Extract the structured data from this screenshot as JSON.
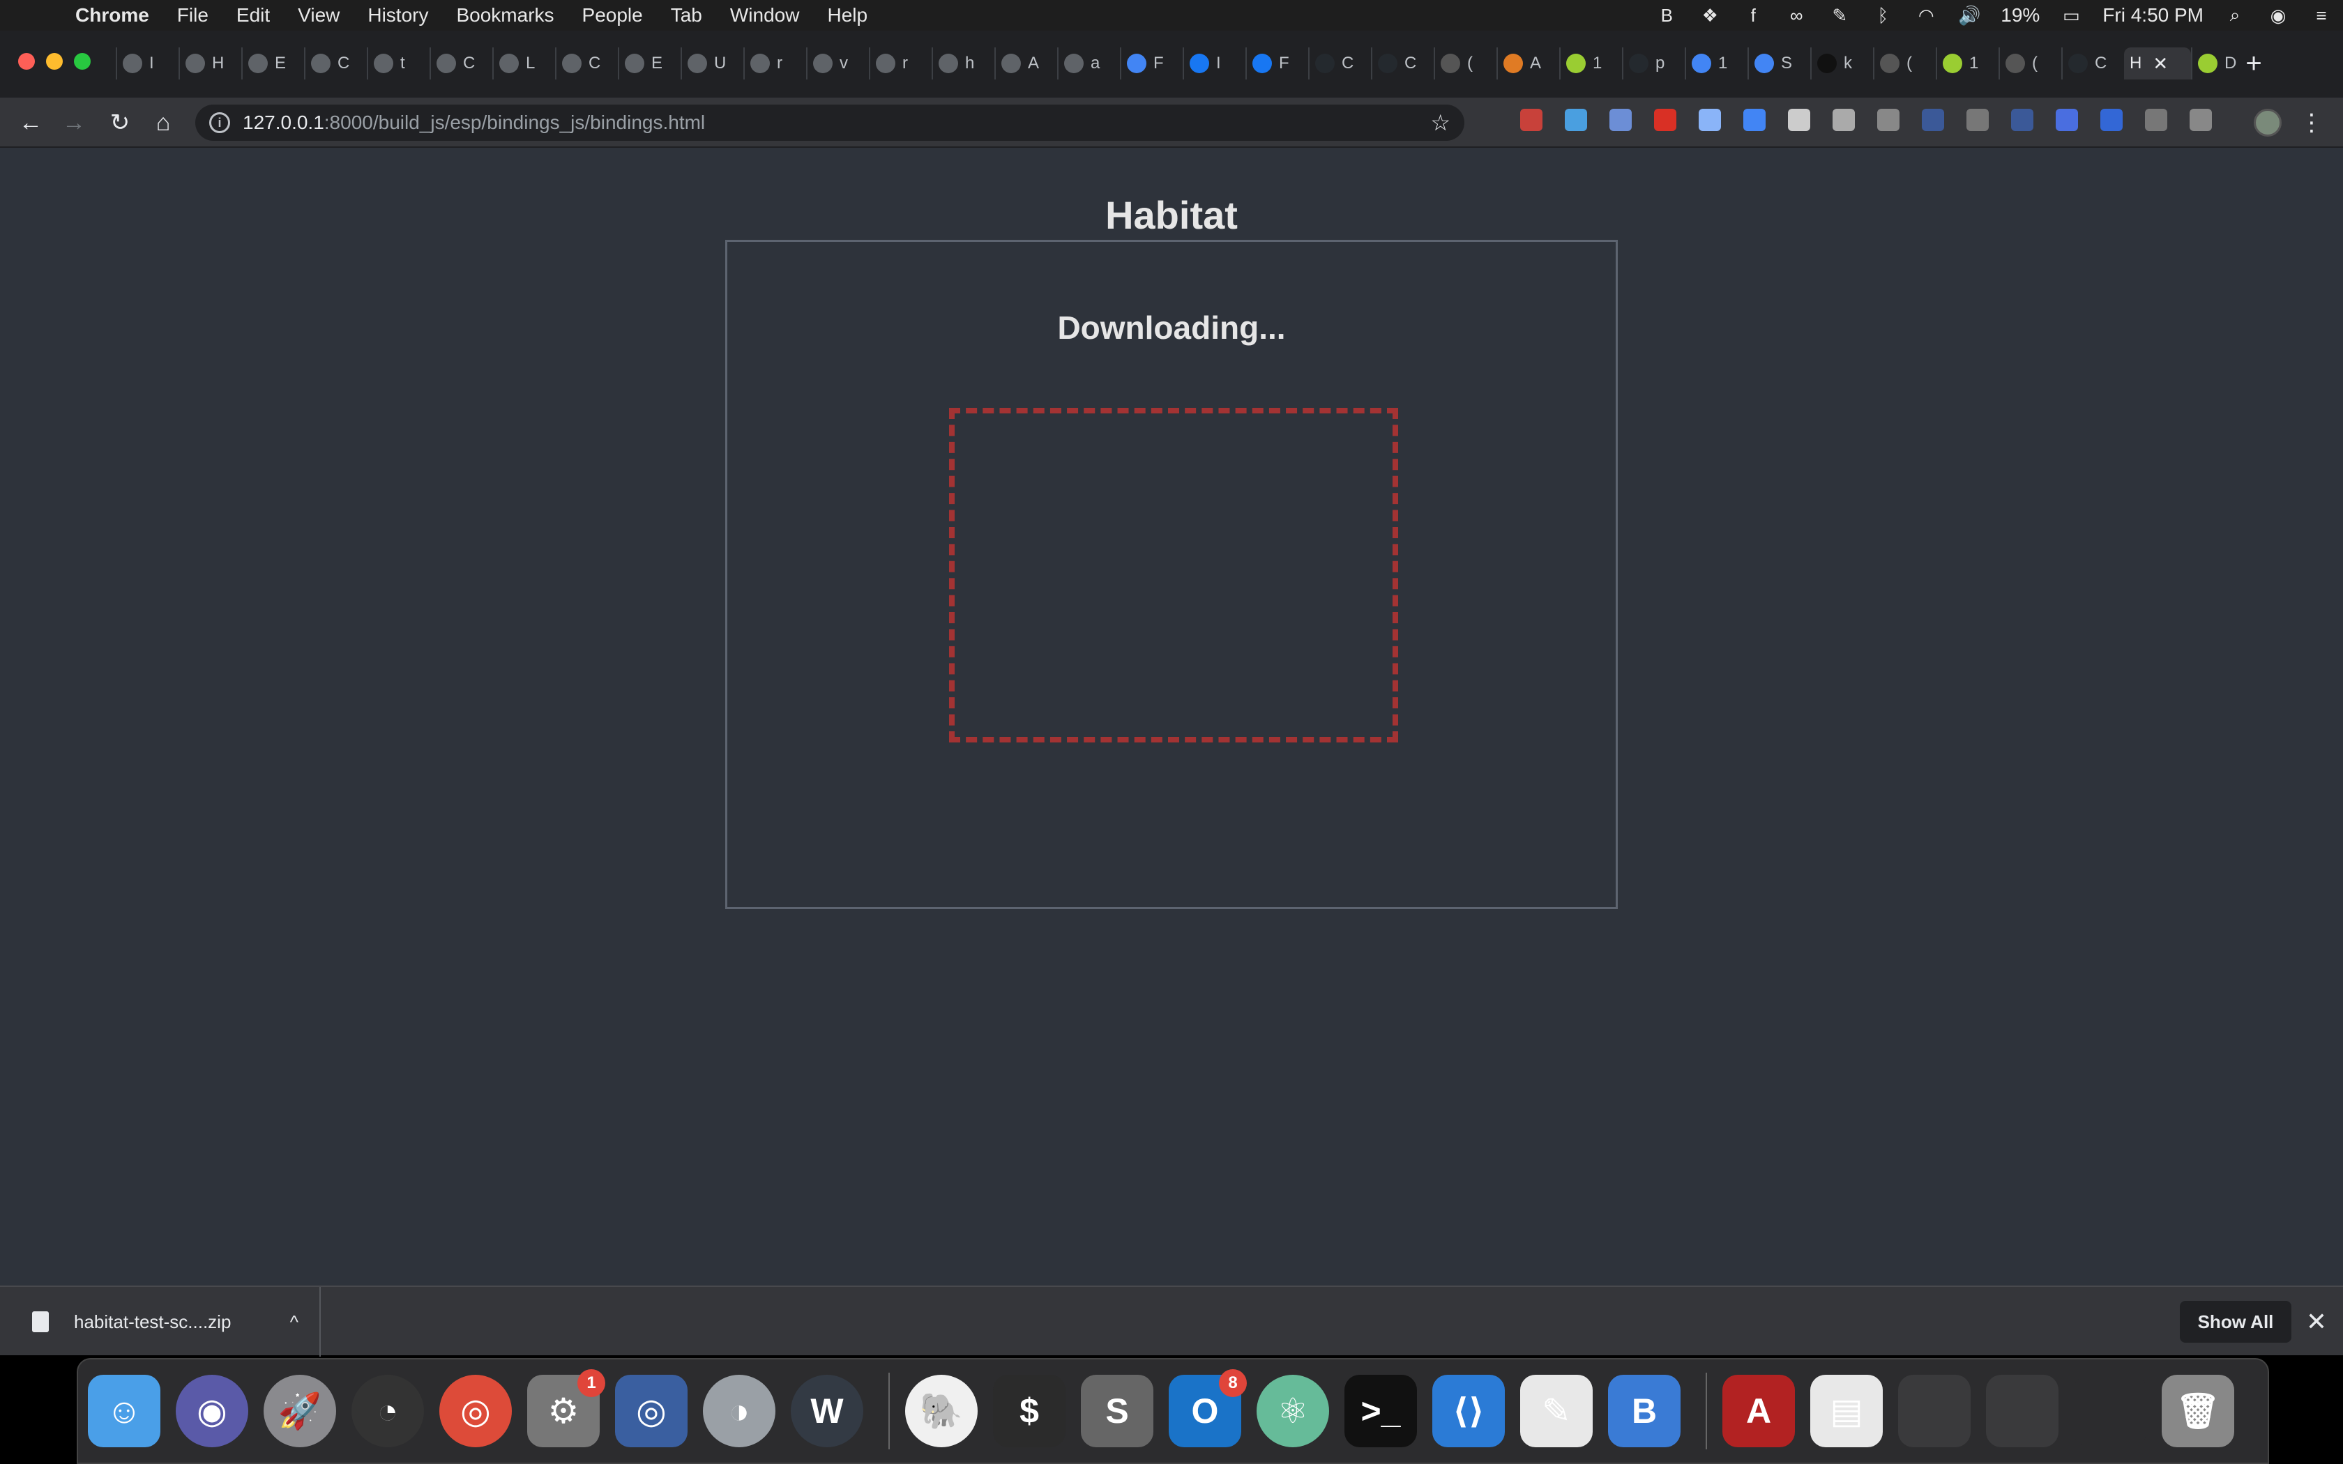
{
  "menubar": {
    "app_name": "Chrome",
    "menus": [
      "File",
      "Edit",
      "View",
      "History",
      "Bookmarks",
      "People",
      "Tab",
      "Window",
      "Help"
    ],
    "battery": "19%",
    "clock": "Fri 4:50 PM"
  },
  "tabs": [
    {
      "fav_color": "#5f6368",
      "text": "I"
    },
    {
      "fav_color": "#5f6368",
      "text": "H"
    },
    {
      "fav_color": "#5f6368",
      "text": "E"
    },
    {
      "fav_color": "#5f6368",
      "text": "C"
    },
    {
      "fav_color": "#5f6368",
      "text": "t"
    },
    {
      "fav_color": "#5f6368",
      "text": "C"
    },
    {
      "fav_color": "#5f6368",
      "text": "L"
    },
    {
      "fav_color": "#5f6368",
      "text": "C"
    },
    {
      "fav_color": "#5f6368",
      "text": "E"
    },
    {
      "fav_color": "#5f6368",
      "text": "U"
    },
    {
      "fav_color": "#5f6368",
      "text": "r"
    },
    {
      "fav_color": "#5f6368",
      "text": "v"
    },
    {
      "fav_color": "#5f6368",
      "text": "r"
    },
    {
      "fav_color": "#5f6368",
      "text": "h"
    },
    {
      "fav_color": "#5f6368",
      "text": "A"
    },
    {
      "fav_color": "#5f6368",
      "text": "a"
    },
    {
      "fav_color": "#4285f4",
      "text": "F"
    },
    {
      "fav_color": "#1877f2",
      "text": "I"
    },
    {
      "fav_color": "#1877f2",
      "text": "F"
    },
    {
      "fav_color": "#24292e",
      "text": "C"
    },
    {
      "fav_color": "#24292e",
      "text": "C"
    },
    {
      "fav_color": "#555555",
      "text": "("
    },
    {
      "fav_color": "#e07b24",
      "text": "A"
    },
    {
      "fav_color": "#9acd32",
      "text": "1"
    },
    {
      "fav_color": "#24292e",
      "text": "p"
    },
    {
      "fav_color": "#4285f4",
      "text": "1"
    },
    {
      "fav_color": "#4285f4",
      "text": "S"
    },
    {
      "fav_color": "#111111",
      "text": "k"
    },
    {
      "fav_color": "#555555",
      "text": "("
    },
    {
      "fav_color": "#9acd32",
      "text": "1"
    },
    {
      "fav_color": "#555555",
      "text": "("
    },
    {
      "fav_color": "#24292e",
      "text": "C"
    }
  ],
  "active_tab": {
    "text": "H",
    "close": "✕"
  },
  "last_tab": {
    "fav_color": "#9acd32",
    "text": "D"
  },
  "new_tab_label": "+",
  "nav": {
    "back": "←",
    "forward": "→",
    "reload": "↻",
    "home": "⌂",
    "menu": "⋮"
  },
  "address": {
    "info": "i",
    "host": "127.0.0.1",
    "path": ":8000/build_js/esp/bindings_js/bindings.html",
    "star": "☆"
  },
  "extension_colors": [
    "#c8413a",
    "#4a9fe0",
    "#6c8ed6",
    "#d93025",
    "#8ab4f8",
    "#4285f4",
    "#cccccc",
    "#aaaaaa",
    "#888888",
    "#3b5998",
    "#777777",
    "#3b5998",
    "#4a6ee0",
    "#3367d6",
    "#777777",
    "#888888"
  ],
  "page": {
    "title": "Habitat",
    "status": "Downloading..."
  },
  "download": {
    "file_name": "habitat-test-sc....zip",
    "chevron": "^",
    "show_all": "Show All",
    "close": "✕"
  },
  "dock": {
    "apps": [
      {
        "name": "finder-icon",
        "color": "#4a9fe8",
        "glyph": "☺",
        "round": false
      },
      {
        "name": "siri-icon",
        "color": "#5a5aa8",
        "glyph": "◉",
        "round": true
      },
      {
        "name": "launchpad-icon",
        "color": "#8a8a8e",
        "glyph": "🚀",
        "round": true
      },
      {
        "name": "activity-monitor-icon",
        "color": "#333333",
        "glyph": "◔",
        "round": true
      },
      {
        "name": "chrome-icon",
        "color": "#dd4b39",
        "glyph": "◎",
        "round": true
      },
      {
        "name": "system-preferences-icon",
        "color": "#777777",
        "glyph": "⚙",
        "round": false,
        "badge": "1"
      },
      {
        "name": "lifesaver-icon",
        "color": "#3a5fa0",
        "glyph": "◎",
        "round": false
      },
      {
        "name": "network-icon",
        "color": "#9aa0a6",
        "glyph": "◑",
        "round": true
      },
      {
        "name": "workplace-icon",
        "color": "#333a44",
        "glyph": "W",
        "round": true
      }
    ],
    "apps2": [
      {
        "name": "evernote-icon",
        "color": "#f0f0f0",
        "glyph": "🐘",
        "round": true
      },
      {
        "name": "terminal-icon",
        "color": "#2b2b2b",
        "glyph": "$",
        "round": false
      },
      {
        "name": "sublime-icon",
        "color": "#666666",
        "glyph": "S",
        "round": false
      },
      {
        "name": "outlook-icon",
        "color": "#1a73c8",
        "glyph": "O",
        "round": false,
        "badge": "8"
      },
      {
        "name": "atom-icon",
        "color": "#66bb99",
        "glyph": "⚛",
        "round": true
      },
      {
        "name": "terminal-2-icon",
        "color": "#111111",
        "glyph": ">_",
        "round": false
      },
      {
        "name": "vscode-icon",
        "color": "#2b7bd6",
        "glyph": "⟨⟩",
        "round": false
      },
      {
        "name": "textedit-icon",
        "color": "#e8e8e8",
        "glyph": "✎",
        "round": false
      },
      {
        "name": "bluejeans-icon",
        "color": "#3a7bd5",
        "glyph": "B",
        "round": false
      }
    ],
    "apps3": [
      {
        "name": "acrobat-icon",
        "color": "#b22222",
        "glyph": "A",
        "round": false
      },
      {
        "name": "csv-file-icon",
        "color": "#e8e8e8",
        "glyph": "▤",
        "round": false
      },
      {
        "name": "chrome-window-1-icon",
        "color": "#3a3a3c",
        "glyph": "",
        "round": false
      },
      {
        "name": "chrome-window-2-icon",
        "color": "#3a3a3c",
        "glyph": "",
        "round": false
      },
      {
        "name": "chrome-window-3-icon",
        "color": "#2c2c2e",
        "glyph": "",
        "round": false
      },
      {
        "name": "trash-icon",
        "color": "#888888",
        "glyph": "🗑",
        "round": false
      }
    ]
  }
}
